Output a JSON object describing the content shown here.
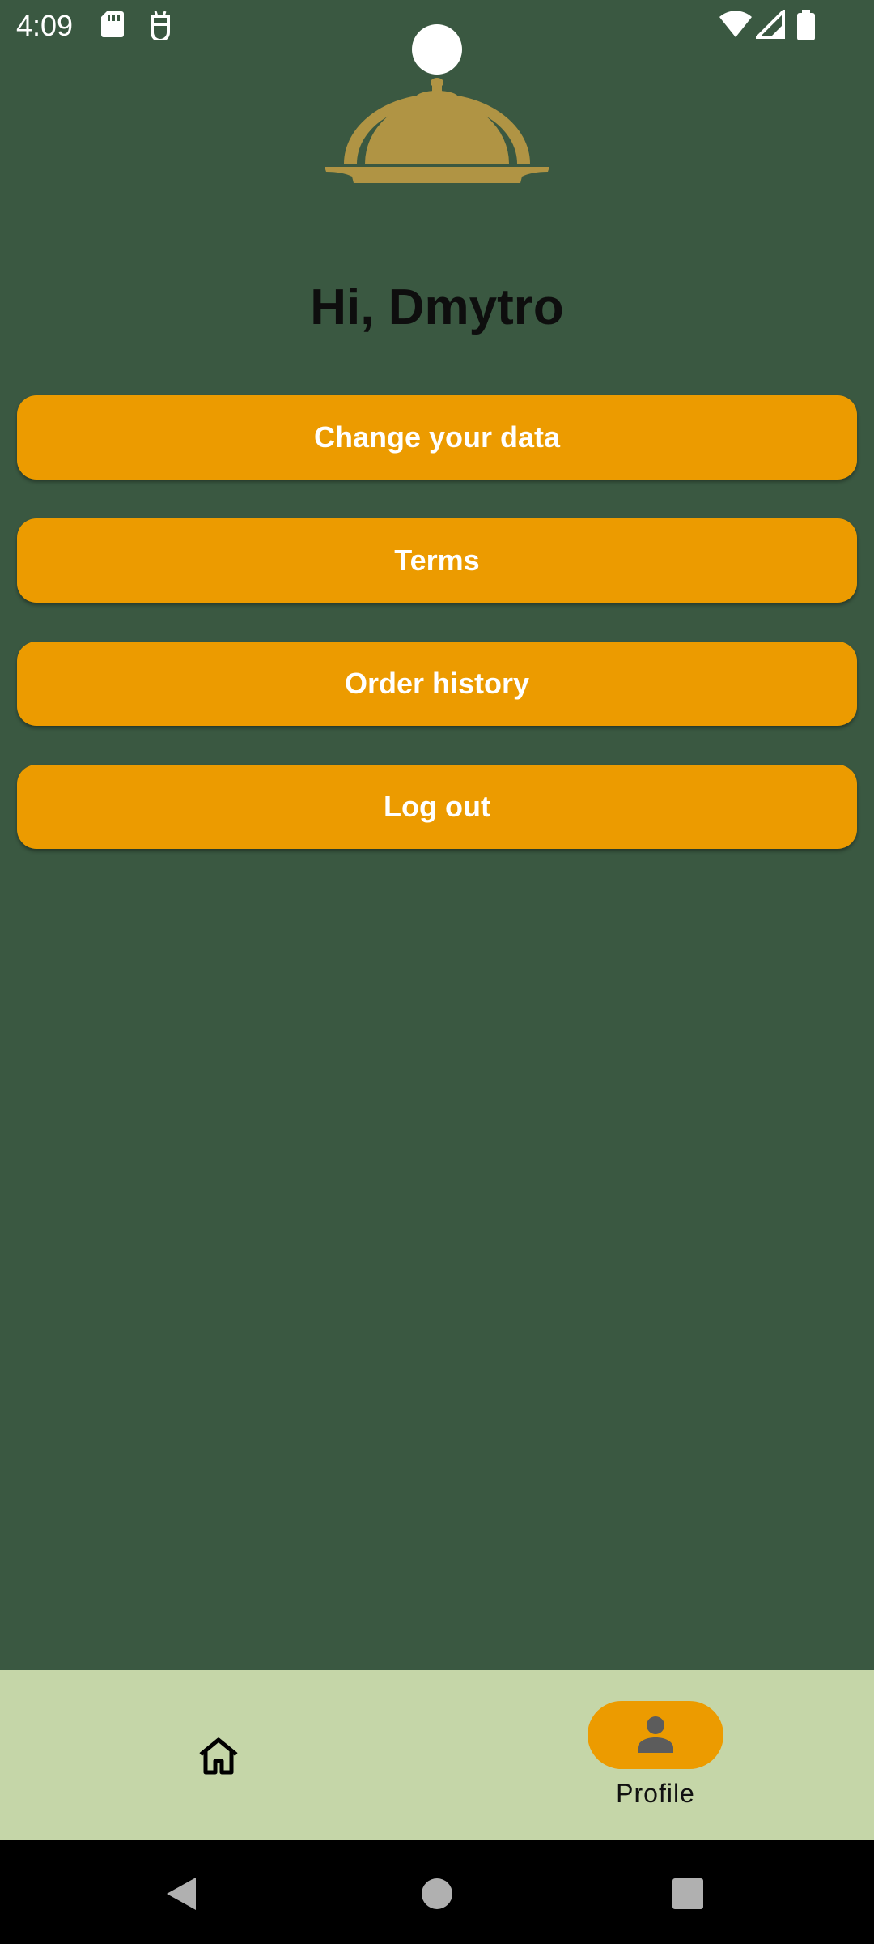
{
  "status_bar": {
    "time": "4:09",
    "icons": [
      "sd-card-icon",
      "debug-icon",
      "wifi-icon",
      "signal-icon",
      "battery-icon"
    ]
  },
  "header": {
    "logo_icon": "cloche-icon",
    "greeting": "Hi, Dmytro"
  },
  "menu": {
    "buttons": [
      {
        "label": "Change your data"
      },
      {
        "label": "Terms"
      },
      {
        "label": "Order history"
      },
      {
        "label": "Log out"
      }
    ]
  },
  "bottom_nav": {
    "items": [
      {
        "icon": "home-icon",
        "label": ""
      },
      {
        "icon": "person-icon",
        "label": "Profile",
        "selected": true
      }
    ]
  },
  "system_nav": {
    "icons": [
      "back-icon",
      "home-circle-icon",
      "recents-icon"
    ]
  },
  "colors": {
    "background": "#3a5841",
    "accent": "#ec9b00",
    "logo": "#b09444",
    "nav_background": "#c5d6a8"
  }
}
